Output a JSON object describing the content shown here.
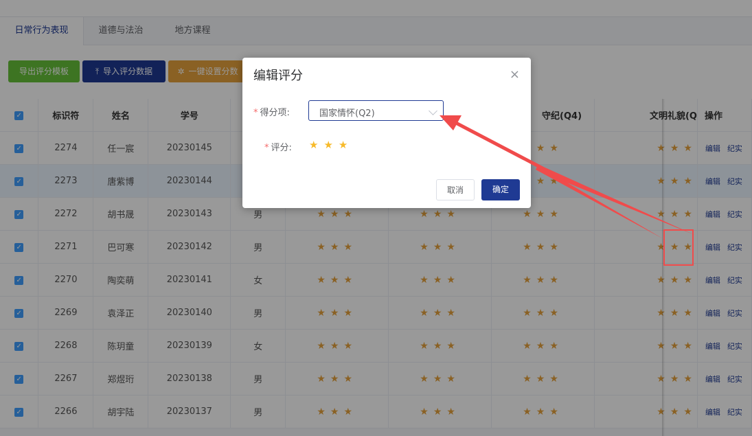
{
  "tabs": [
    "日常行为表现",
    "道德与法治",
    "地方课程"
  ],
  "toolbar": {
    "export_label": "导出评分模板",
    "import_label": "导入评分数据",
    "set_label": "一键设置分数"
  },
  "table": {
    "headers": [
      "标识符",
      "姓名",
      "学号",
      "",
      "",
      "",
      "守纪(Q4)",
      "文明礼貌(Q",
      "操作"
    ],
    "op_edit": "编辑",
    "op_record": "纪实",
    "stars": "★★★",
    "rows": [
      {
        "id": "2274",
        "name": "任一宸",
        "no": "20230145",
        "gender": ""
      },
      {
        "id": "2273",
        "name": "唐紫博",
        "no": "20230144",
        "gender": ""
      },
      {
        "id": "2272",
        "name": "胡书晟",
        "no": "20230143",
        "gender": "男"
      },
      {
        "id": "2271",
        "name": "巴可寒",
        "no": "20230142",
        "gender": "男"
      },
      {
        "id": "2270",
        "name": "陶奕萌",
        "no": "20230141",
        "gender": "女"
      },
      {
        "id": "2269",
        "name": "袁泽正",
        "no": "20230140",
        "gender": "男"
      },
      {
        "id": "2268",
        "name": "陈玥童",
        "no": "20230139",
        "gender": "女"
      },
      {
        "id": "2267",
        "name": "郑煜珩",
        "no": "20230138",
        "gender": "男"
      },
      {
        "id": "2266",
        "name": "胡宇陆",
        "no": "20230137",
        "gender": "男"
      }
    ]
  },
  "dialog": {
    "title": "编辑评分",
    "close": "×",
    "score_item_label": "得分项:",
    "score_item_value": "国家情怀(Q2)",
    "rating_label": "评分:",
    "rating_stars": "★★★",
    "cancel_label": "取消",
    "ok_label": "确定"
  },
  "colors": {
    "primary": "#1f3a93",
    "success": "#67c23a",
    "warning": "#e6a23c",
    "annotation": "#f04b4b"
  },
  "icons": {
    "import": "upload-icon",
    "set": "gear-icon",
    "check": "checkbox-checked-icon"
  }
}
